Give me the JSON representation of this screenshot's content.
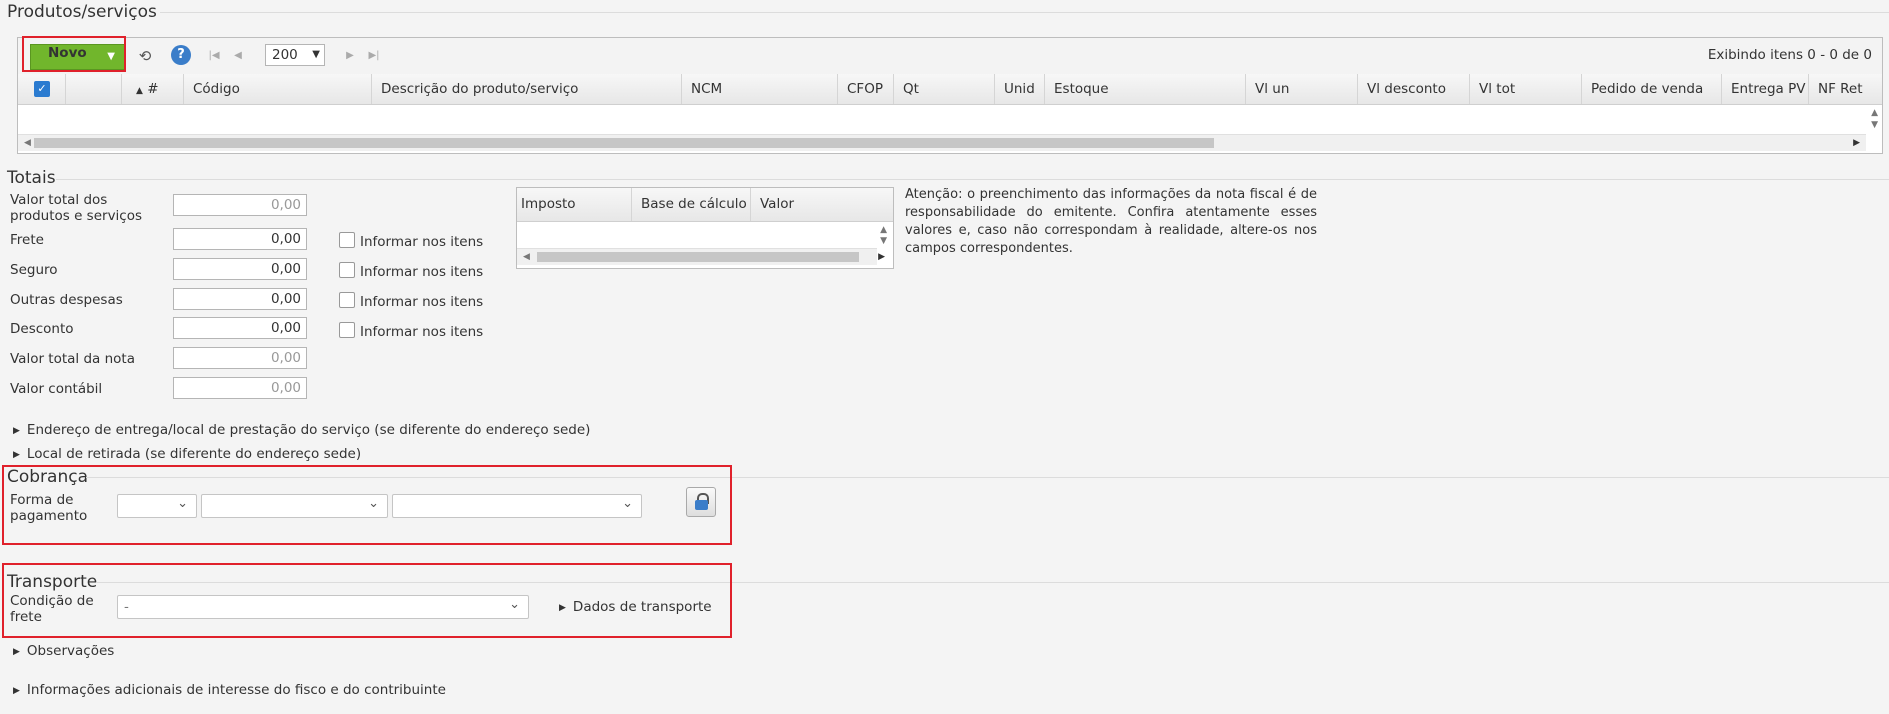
{
  "produtos": {
    "title": "Produtos/serviços",
    "novo_label": "Novo",
    "page_size": "200",
    "showing": "Exibindo itens 0 - 0 de 0",
    "columns": [
      "#",
      "Código",
      "Descrição do produto/serviço",
      "NCM",
      "CFOP",
      "Qt",
      "Unid",
      "Estoque",
      "Vl un",
      "Vl desconto",
      "Vl tot",
      "Pedido de venda",
      "Entrega PV",
      "NF Ret"
    ]
  },
  "totais": {
    "title": "Totais",
    "rows": [
      {
        "label": "Valor total dos produtos e serviços",
        "value": "0,00"
      },
      {
        "label": "Frete",
        "value": "0,00"
      },
      {
        "label": "Seguro",
        "value": "0,00"
      },
      {
        "label": "Outras despesas",
        "value": "0,00"
      },
      {
        "label": "Desconto",
        "value": "0,00"
      },
      {
        "label": "Valor total da nota",
        "value": "0,00"
      },
      {
        "label": "Valor contábil",
        "value": "0,00"
      }
    ],
    "informar_label": "Informar nos itens",
    "tax_columns": [
      "Imposto",
      "Base de cálculo",
      "Valor"
    ],
    "note": "Atenção: o preenchimento das informações da nota fiscal é de responsabilidade do emitente. Confira atentamente esses valores e, caso não correspondam à realidade, altere-os nos campos correspondentes."
  },
  "expanders": {
    "endereco": "Endereço de entrega/local de prestação do serviço (se diferente do endereço sede)",
    "retirada": "Local de retirada (se diferente do endereço sede)",
    "observacoes": "Observações",
    "info_adicionais": "Informações adicionais de interesse do fisco e do contribuinte",
    "dados_transporte": "Dados de transporte"
  },
  "cobranca": {
    "title": "Cobrança",
    "forma_label": "Forma de pagamento"
  },
  "transporte": {
    "title": "Transporte",
    "condicao_label": "Condição de frete",
    "condicao_value": "-"
  },
  "colors": {
    "accent_green": "#71b62c",
    "highlight_red": "#e0212b"
  }
}
